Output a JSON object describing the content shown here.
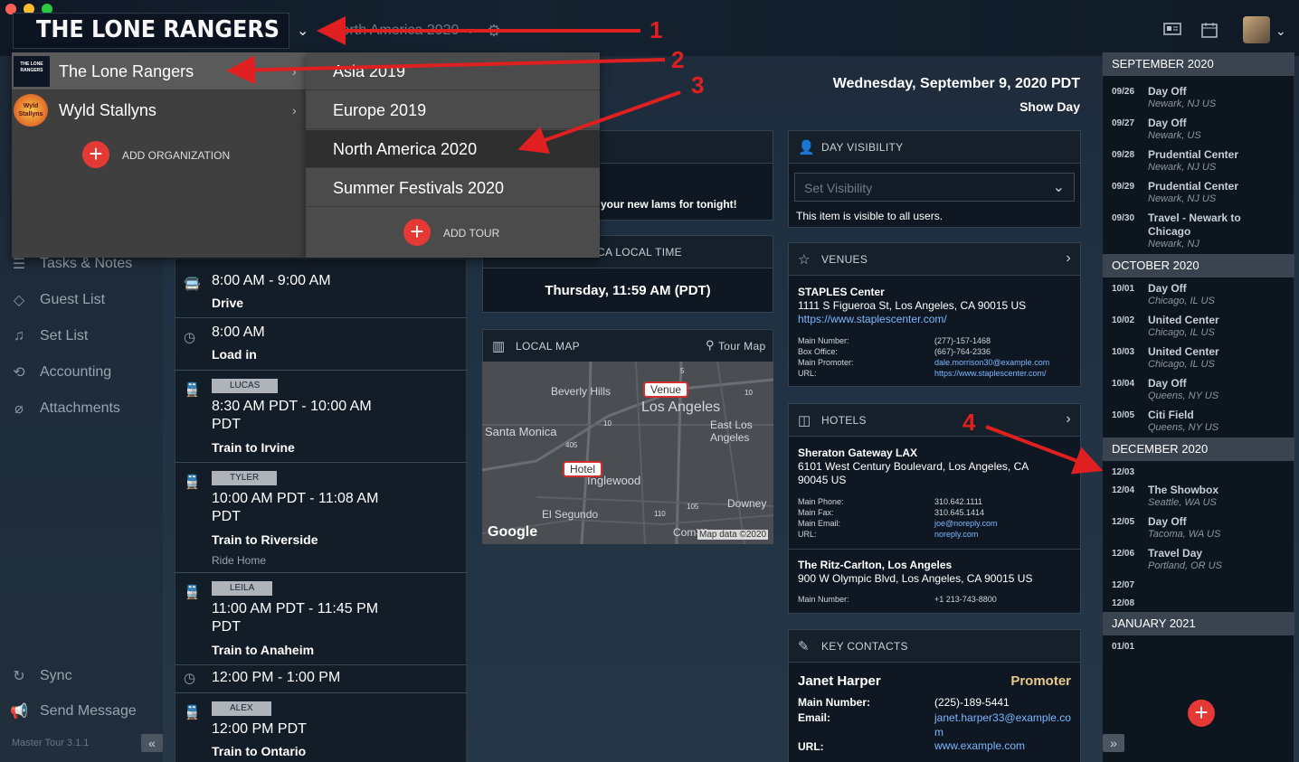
{
  "header": {
    "org_logo_text": "THE LONE RANGERS",
    "tour_select": "North America 2020",
    "date": "Wednesday, September 9, 2020 PDT",
    "day_type": "Show Day"
  },
  "org_dropdown": {
    "items": [
      {
        "name": "The Lone Rangers",
        "logo": "THE LONE RANGERS"
      },
      {
        "name": "Wyld Stallyns",
        "logo": "Wyld Stallyns"
      }
    ],
    "add_label": "ADD ORGANIZATION"
  },
  "tour_dropdown": {
    "items": [
      "Asia 2019",
      "Europe 2019",
      "North America 2020",
      "Summer Festivals 2020"
    ],
    "add_label": "ADD TOUR"
  },
  "sidebar": {
    "items": [
      {
        "label": "Tasks & Notes",
        "icon": "list-icon"
      },
      {
        "label": "Guest List",
        "icon": "ticket-icon"
      },
      {
        "label": "Set List",
        "icon": "music-note-icon"
      },
      {
        "label": "Accounting",
        "icon": "money-icon"
      },
      {
        "label": "Attachments",
        "icon": "paperclip-icon"
      }
    ],
    "sync": "Sync",
    "send_message": "Send Message",
    "version": "Master Tour 3.1.1",
    "collapse": "«"
  },
  "schedule": [
    {
      "time": "8:00 AM - 9:00 AM",
      "title": "Drive",
      "icon": "bus-icon"
    },
    {
      "time": "8:00 AM",
      "title": "Load in",
      "icon": "clock-icon"
    },
    {
      "tag": "LUCAS",
      "time": "8:30 AM PDT - 10:00 AM PDT",
      "title": "Train to Irvine",
      "icon": "train-icon"
    },
    {
      "tag": "TYLER",
      "time": "10:00 AM PDT - 11:08 AM PDT",
      "title": "Train to Riverside",
      "sub": "Ride Home",
      "icon": "train-icon"
    },
    {
      "tag": "LEILA",
      "time": "11:00 AM PDT - 11:45 PM PDT",
      "title": "Train to Anaheim",
      "icon": "train-icon"
    },
    {
      "time": "12:00 PM - 1:00 PM",
      "icon": "clock-icon"
    },
    {
      "tag": "ALEX",
      "time": "12:00 PM PDT",
      "title": "Train to Ontario",
      "icon": "train-icon"
    }
  ],
  "notes_card": {
    "text": "your new lams for tonight!"
  },
  "local_time": {
    "heading": "CA LOCAL TIME",
    "value": "Thursday, 11:59 AM (PDT)"
  },
  "local_map": {
    "heading": "LOCAL MAP",
    "tour_map": "Tour Map",
    "labels": [
      "Beverly Hills",
      "Los Angeles",
      "East Los Angeles",
      "Santa Monica",
      "Inglewood",
      "El Segundo",
      "Downey",
      "Com"
    ],
    "venue_pin": "Venue",
    "hotel_pin": "Hotel",
    "google": "Google",
    "copyright": "Map data ©2020",
    "roads": [
      "5",
      "10",
      "10",
      "405",
      "105",
      "110",
      "105"
    ]
  },
  "day_visibility": {
    "heading": "DAY VISIBILITY",
    "placeholder": "Set Visibility",
    "note": "This item is visible to all users."
  },
  "venues": {
    "heading": "VENUES",
    "name": "STAPLES Center",
    "address": "1111 S Figueroa St, Los Angeles, CA 90015 US",
    "url": "https://www.staplescenter.com/",
    "labels": [
      "Main Number:",
      "Box Office:",
      "Main Promoter:",
      "URL:"
    ],
    "values": [
      "(277)-157-1468",
      "(667)-764-2336",
      "dale.morrison30@example.com",
      "https://www.staplescenter.com/"
    ]
  },
  "hotels": {
    "heading": "HOTELS",
    "h1_name": "Sheraton Gateway LAX",
    "h1_address": "6101 West Century Boulevard, Los Angeles, CA 90045 US",
    "h1_labels": [
      "Main Phone:",
      "Main Fax:",
      "Main Email:",
      "URL:"
    ],
    "h1_values": [
      "310.642.1111",
      "310.645.1414",
      "joe@noreply.com",
      "noreply.com"
    ],
    "h2_name": "The Ritz-Carlton, Los Angeles",
    "h2_address": "900 W Olympic Blvd, Los Angeles, CA 90015 US",
    "h2_label": "Main Number:",
    "h2_value": "+1 213-743-8800"
  },
  "key_contacts": {
    "heading": "KEY CONTACTS",
    "name": "Janet Harper",
    "role": "Promoter",
    "main_label": "Main Number:",
    "main_value": "(225)-189-5441",
    "email_label": "Email:",
    "email_value": "janet.harper33@example.com",
    "url_label": "URL:",
    "url_value": "www.example.com"
  },
  "calendar": {
    "months": [
      {
        "name": "SEPTEMBER 2020",
        "days": [
          {
            "d": "09/26",
            "t": "Day Off",
            "l": "Newark, NJ US"
          },
          {
            "d": "09/27",
            "t": "Day Off",
            "l": "Newark, US"
          },
          {
            "d": "09/28",
            "t": "Prudential Center",
            "l": "Newark, NJ US"
          },
          {
            "d": "09/29",
            "t": "Prudential Center",
            "l": "Newark, NJ US"
          },
          {
            "d": "09/30",
            "t": "Travel - Newark to Chicago",
            "l": "Newark, NJ"
          }
        ]
      },
      {
        "name": "OCTOBER 2020",
        "days": [
          {
            "d": "10/01",
            "t": "Day Off",
            "l": "Chicago, IL US"
          },
          {
            "d": "10/02",
            "t": "United Center",
            "l": "Chicago, IL US"
          },
          {
            "d": "10/03",
            "t": "United Center",
            "l": "Chicago, IL US"
          },
          {
            "d": "10/04",
            "t": "Day Off",
            "l": "Queens, NY US"
          },
          {
            "d": "10/05",
            "t": "Citi Field",
            "l": "Queens, NY US"
          }
        ]
      },
      {
        "name": "DECEMBER 2020",
        "days": [
          {
            "d": "12/03",
            "t": "",
            "l": ""
          },
          {
            "d": "12/04",
            "t": "The Showbox",
            "l": "Seattle, WA US"
          },
          {
            "d": "12/05",
            "t": "Day Off",
            "l": "Tacoma, WA US"
          },
          {
            "d": "12/06",
            "t": "Travel Day",
            "l": "Portland, OR US"
          },
          {
            "d": "12/07",
            "t": "",
            "l": ""
          },
          {
            "d": "12/08",
            "t": "",
            "l": ""
          }
        ]
      },
      {
        "name": "JANUARY 2021",
        "days": [
          {
            "d": "01/01",
            "t": "",
            "l": ""
          }
        ]
      }
    ],
    "expand": "»"
  },
  "annotations": [
    "1",
    "2",
    "3",
    "4"
  ],
  "colors": {
    "accent_red": "#e53935",
    "annotation_red": "#e02020",
    "link_blue": "#7db6ff"
  }
}
